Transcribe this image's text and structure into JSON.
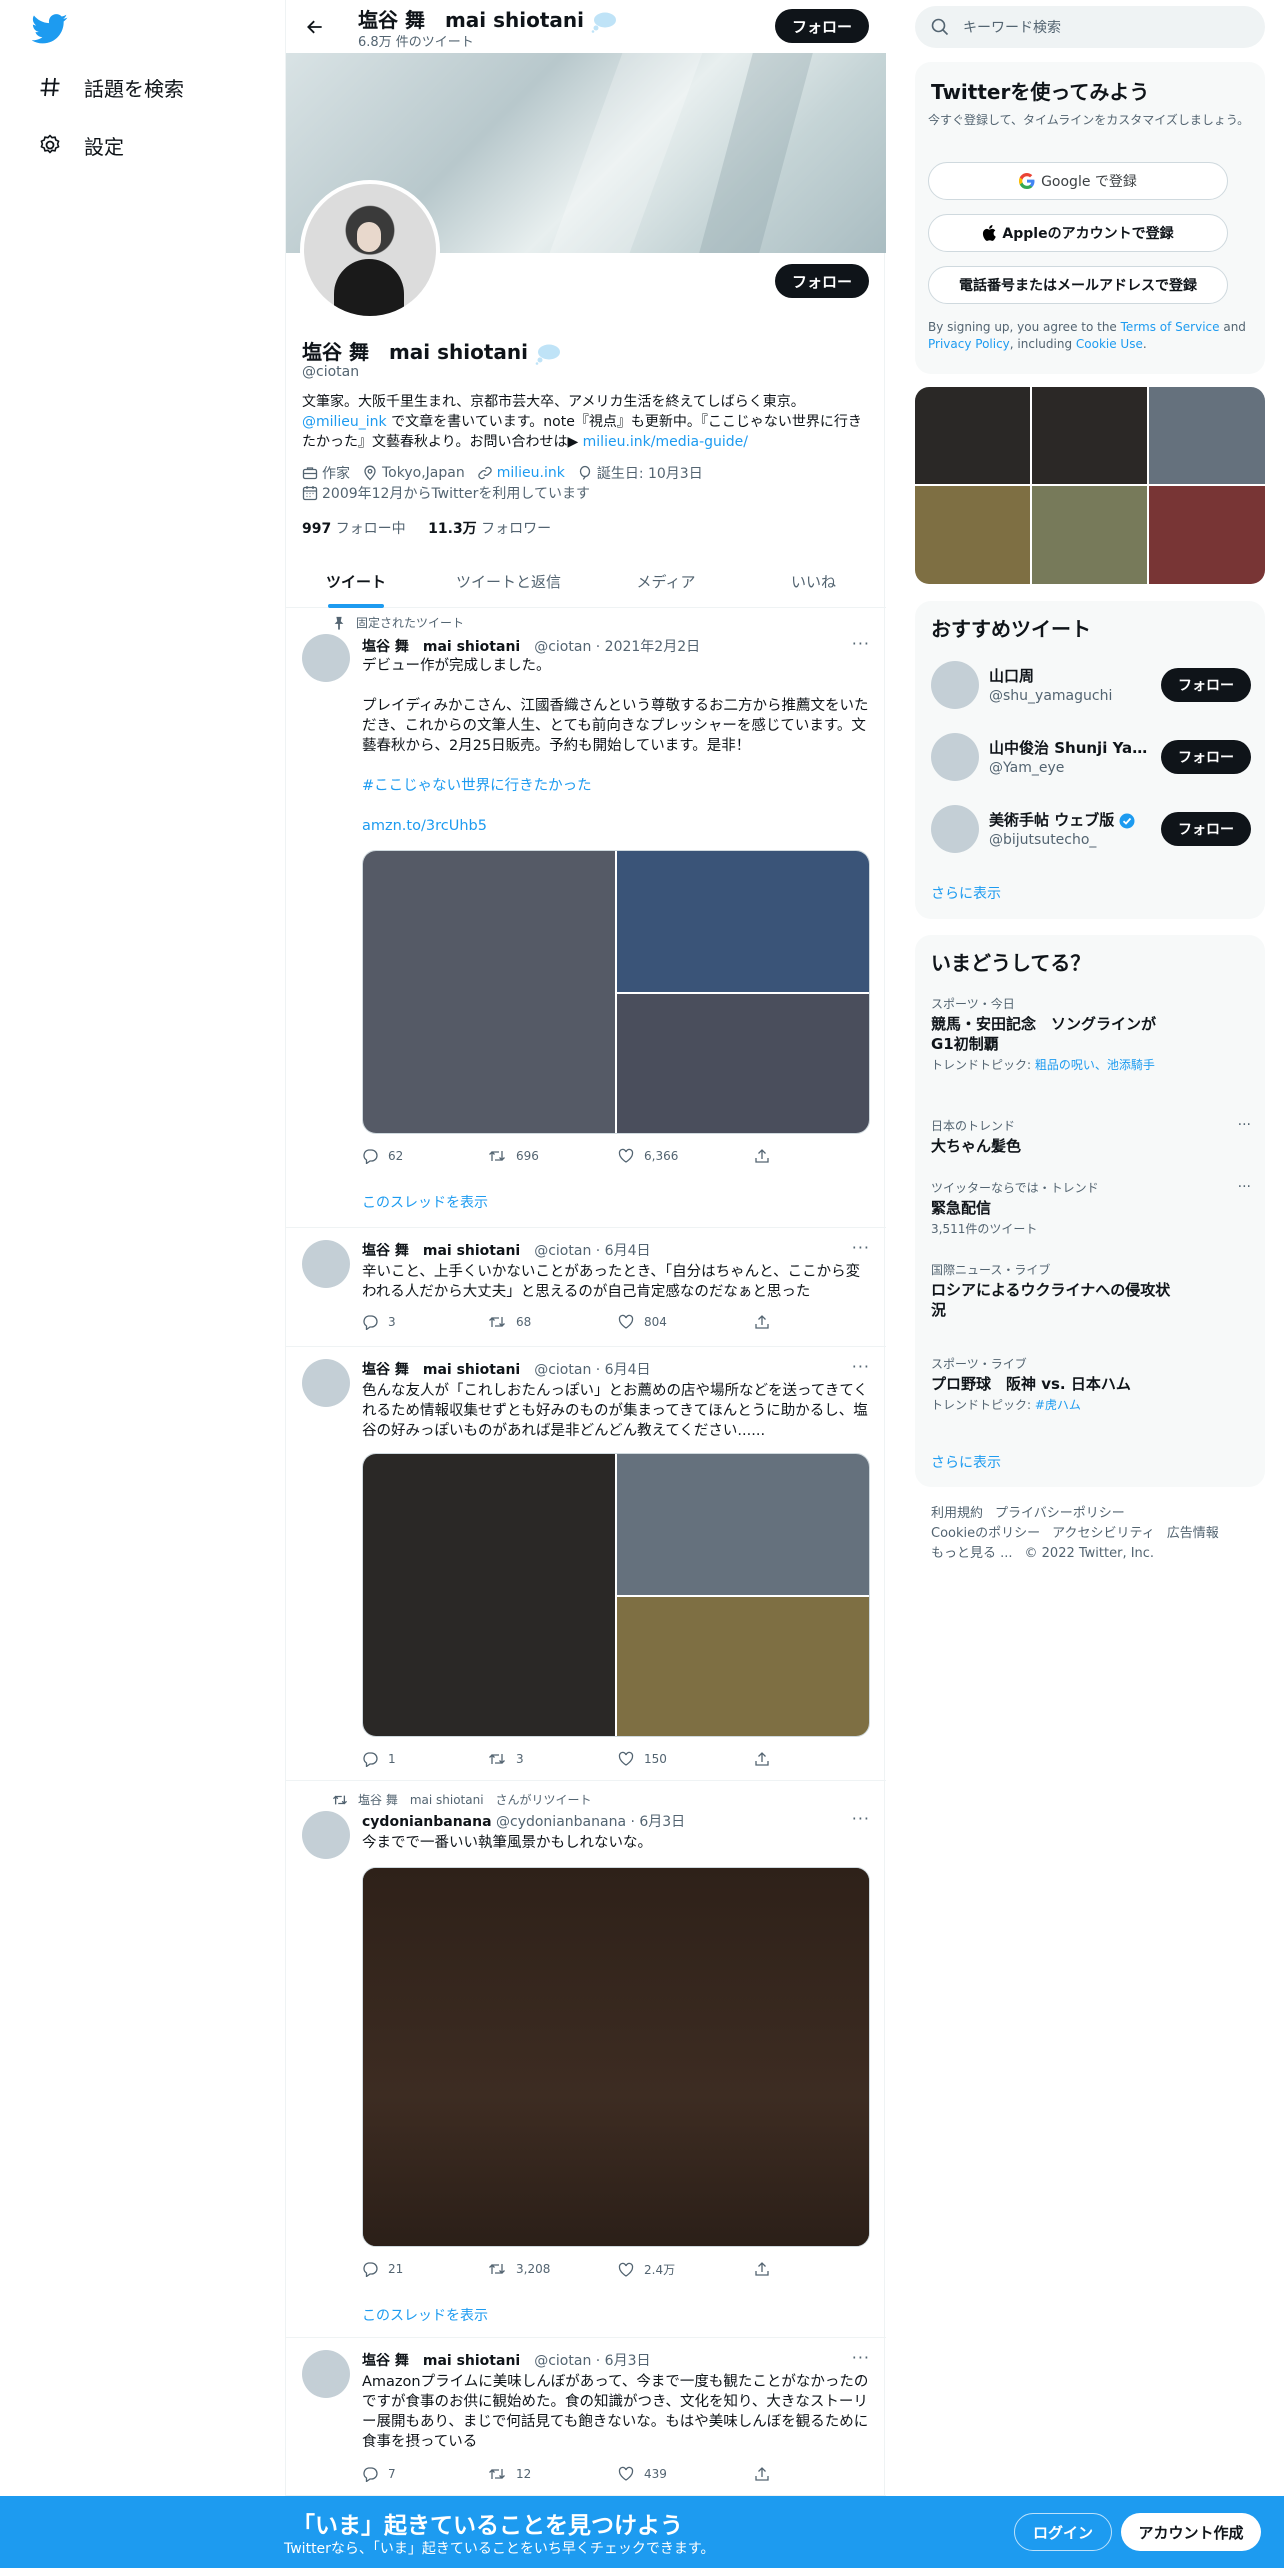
{
  "nav": {
    "explore_label": "話題を検索",
    "settings_label": "設定"
  },
  "header": {
    "name": "塩谷 舞　mai shiotani",
    "tweet_count": "6.8万 件のツイート",
    "follow_label": "フォロー"
  },
  "profile": {
    "name": "塩谷 舞　mai shiotani",
    "handle": "@ciotan",
    "follow_label": "フォロー",
    "bio_1": "文筆家。大阪千里生まれ、京都市芸大卒、アメリカ生活を終えてしばらく東京。",
    "bio_link_1": "@milieu_ink",
    "bio_2": " で文章を書いています。note『視点』も更新中。『ここじゃない世界に行きたかった』文藝春秋より。お問い合わせは▶ ",
    "bio_link_2": "milieu.ink/media-guide/",
    "profession": "作家",
    "location": "Tokyo,Japan",
    "website": "milieu.ink",
    "birthday": "誕生日: 10月3日",
    "joined": "2009年12月からTwitterを利用しています",
    "following_count": "997",
    "following_label": "フォロー中",
    "followers_count": "11.3万",
    "followers_label": "フォロワー"
  },
  "tabs": [
    "ツイート",
    "ツイートと返信",
    "メディア",
    "いいね"
  ],
  "tweets": [
    {
      "context": "固定されたツイート",
      "name": "塩谷 舞　mai shiotani",
      "meta": "@ciotan · 2021年2月2日",
      "text_1": "デビュー作が完成しました。",
      "text_2": "プレイディみかこさん、江國香織さんという尊敬するお二方から推薦文をいただき、これからの文筆人生、とても前向きなプレッシャーを感じています。文藝春秋から、2月25日販売。予約も開始しています。是非！",
      "hashtag": "#ここじゃない世界に行きたかった",
      "url": "amzn.to/3rcUhb5",
      "replies": "62",
      "retweets": "696",
      "likes": "6,366",
      "show_thread": "このスレッドを表示"
    },
    {
      "name": "塩谷 舞　mai shiotani",
      "meta": "@ciotan · 6月4日",
      "text": "辛いこと、上手くいかないことがあったとき、「自分はちゃんと、ここから変われる人だから大丈夫」と思えるのが自己肯定感なのだなぁと思った",
      "replies": "3",
      "retweets": "68",
      "likes": "804"
    },
    {
      "name": "塩谷 舞　mai shiotani",
      "meta": "@ciotan · 6月4日",
      "text": "色んな友人が「これしおたんっぽい」とお薦めの店や場所などを送ってきてくれるため情報収集せずとも好みのものが集まってきてほんとうに助かるし、塩谷の好みっぽいものがあれば是非どんどん教えてください......",
      "replies": "1",
      "retweets": "3",
      "likes": "150"
    },
    {
      "context": "塩谷 舞　mai shiotani　さんがリツイート",
      "name": "cydonianbanana",
      "meta": "@cydonianbanana · 6月3日",
      "text": "今までで一番いい執筆風景かもしれないな。",
      "replies": "21",
      "retweets": "3,208",
      "likes": "2.4万",
      "show_thread": "このスレッドを表示"
    },
    {
      "name": "塩谷 舞　mai shiotani",
      "meta": "@ciotan · 6月3日",
      "text": "Amazonプライムに美味しんぼがあって、今まで一度も観たことがなかったのですが食事のお供に観始めた。食の知識がつき、文化を知り、大きなストーリー展開もあり、まじで何話見ても飽きないな。もはや美味しんぼを観るために食事を摂っている",
      "replies": "7",
      "retweets": "12",
      "likes": "439"
    }
  ],
  "search": {
    "placeholder": "キーワード検索"
  },
  "signup": {
    "title": "Twitterを使ってみよう",
    "subtitle": "今すぐ登録して、タイムラインをカスタマイズしましょう。",
    "google": "Google で登録",
    "apple": "Appleのアカウントで登録",
    "phone": "電話番号またはメールアドレスで登録",
    "legal_1": "By signing up, you agree to the ",
    "tos": "Terms of Service",
    "legal_2": " and ",
    "privacy": "Privacy Policy",
    "legal_3": ", including ",
    "cookie": "Cookie Use",
    "legal_4": "."
  },
  "recommend": {
    "title": "おすすめツイート",
    "follow_label": "フォロー",
    "users": [
      {
        "name": "山口周",
        "handle": "@shu_yamaguchi"
      },
      {
        "name": "山中俊治 Shunji Yam...",
        "handle": "@Yam_eye"
      },
      {
        "name": "美術手帖 ウェブ版",
        "handle": "@bijutsutecho_"
      }
    ],
    "more": "さらに表示"
  },
  "trends": {
    "title": "いまどうしてる？",
    "items": [
      {
        "context": "スポーツ・今日",
        "title": "競馬・安田記念　ソングラインがG1初制覇",
        "extra_1": "トレンドトピック: ",
        "extra_link": "粗品の呪い、池添騎手"
      },
      {
        "context": "日本のトレンド",
        "title": "大ちゃん髪色"
      },
      {
        "context": "ツイッターならでは・トレンド",
        "title": "緊急配信",
        "extra": "3,511件のツイート"
      },
      {
        "context": "国際ニュース・ライブ",
        "title": "ロシアによるウクライナへの侵攻状況"
      },
      {
        "context": "スポーツ・ライブ",
        "title": "プロ野球　阪神 vs. 日本ハム",
        "extra_1": "トレンドトピック: ",
        "extra_link": "#虎ハム"
      }
    ],
    "more": "さらに表示"
  },
  "footer": {
    "tos": "利用規約",
    "privacy": "プライバシーポリシー",
    "cookie": "Cookieのポリシー",
    "access": "アクセシビリティ",
    "ads": "広告情報",
    "more": "もっと見る ...",
    "copy": "© 2022 Twitter, Inc."
  },
  "bottom": {
    "title": "「いま」起きていることを見つけよう",
    "subtitle": "Twitterなら、「いま」起きていることをいち早くチェックできます。",
    "login": "ログイン",
    "signup": "アカウント作成"
  },
  "colors": {
    "accent": "#1d9bf0",
    "text": "#0f1419",
    "muted": "#536471"
  }
}
